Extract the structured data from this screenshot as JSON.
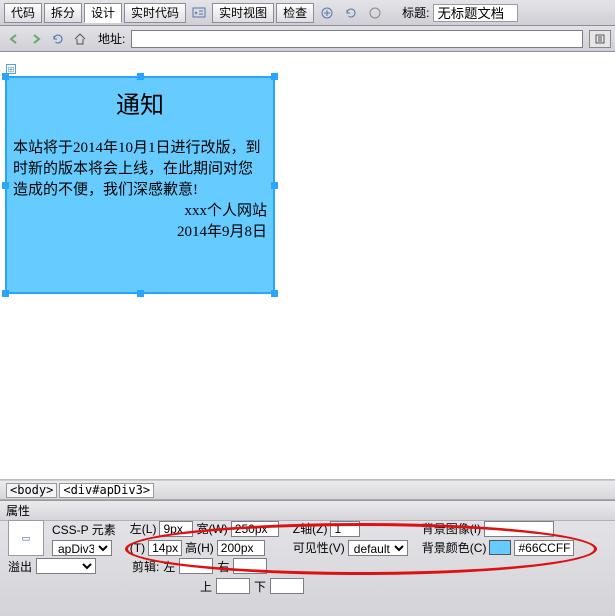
{
  "toolbar": {
    "tabs": [
      {
        "label": "代码"
      },
      {
        "label": "拆分"
      },
      {
        "label": "设计"
      },
      {
        "label": "实时代码"
      },
      {
        "label": "实时视图"
      },
      {
        "label": "检查"
      }
    ],
    "title_label": "标题:",
    "title_value": "无标题文档"
  },
  "addr": {
    "label": "地址:",
    "value": ""
  },
  "apdiv": {
    "title": "通知",
    "body": "本站将于2014年10月1日进行改版，到时新的版本将会上线，在此期间对您造成的不便，我们深感歉意!",
    "sig1": "xxx个人网站",
    "sig2": "2014年9月8日"
  },
  "tagpath": {
    "seg1": "<body>",
    "seg2": "<div#apDiv3>"
  },
  "props": {
    "panel_title": "属性",
    "cssp_label": "CSS-P 元素",
    "id_value": "apDiv3",
    "left_label": "左(L)",
    "left_value": "9px",
    "top_label": "(T)",
    "top_value": "14px",
    "width_label": "宽(W)",
    "width_value": "250px",
    "height_label": "高(H)",
    "height_value": "200px",
    "z_label": "Z轴(Z)",
    "z_value": "1",
    "vis_label": "可见性(V)",
    "vis_value": "default",
    "bgimg_label": "背景图像(I)",
    "bgimg_value": "",
    "bgcolor_label": "背景颜色(C)",
    "bgcolor_value": "#66CCFF",
    "overflow_label": "溢出",
    "clip_label": "剪辑:",
    "left2_label": "左",
    "right2_label": "右",
    "top2_label": "上",
    "bottom2_label": "下"
  }
}
